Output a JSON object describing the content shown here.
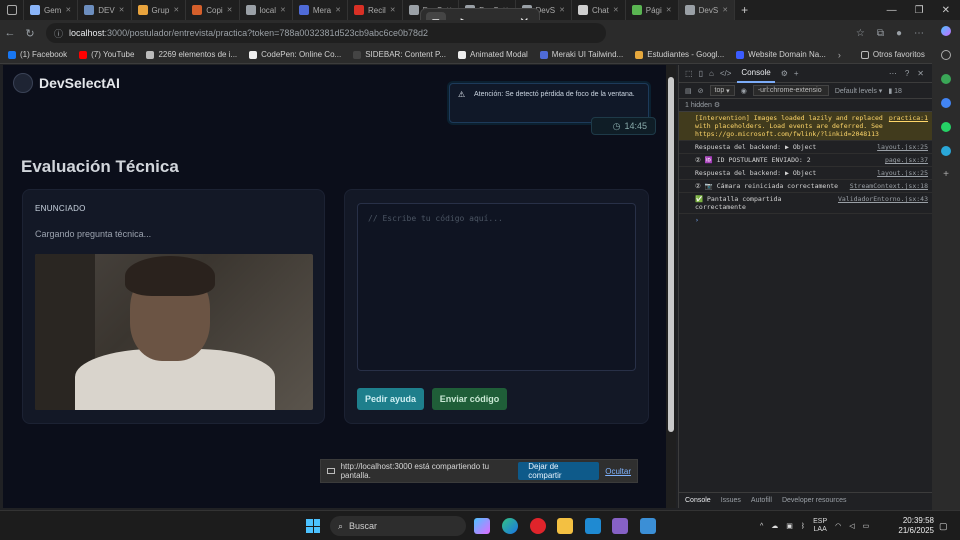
{
  "browser": {
    "tabs": [
      {
        "label": "Gem",
        "color": "#8ab4f8"
      },
      {
        "label": "DEV",
        "color": "#6c8ebf"
      },
      {
        "label": "Grup",
        "color": "#e8a33d"
      },
      {
        "label": "Copi",
        "color": "#d55f2b"
      },
      {
        "label": "local",
        "color": "#9aa0a6"
      },
      {
        "label": "Mera",
        "color": "#4f6bd8"
      },
      {
        "label": "Recil",
        "color": "#d93025"
      },
      {
        "label": "DevS",
        "color": "#9aa0a6"
      },
      {
        "label": "DevS",
        "color": "#9aa0a6"
      },
      {
        "label": "DevS",
        "color": "#9aa0a6"
      },
      {
        "label": "Chat",
        "color": "#cfcfcf"
      },
      {
        "label": "Pági",
        "color": "#5ab552"
      },
      {
        "label": "DevS",
        "color": "#9aa0a6"
      }
    ],
    "url_host": "localhost",
    "url_rest": ":3000/postulador/entrevista/practica?token=788a0032381d523cb9abc6ce0b78d2",
    "bookmarks": [
      {
        "label": "(1) Facebook",
        "color": "#1877f2"
      },
      {
        "label": "(7) YouTube",
        "color": "#ff0000"
      },
      {
        "label": "2269 elementos de i...",
        "color": "#bbbbbb"
      },
      {
        "label": "CodePen: Online Co...",
        "color": "#eeeeee"
      },
      {
        "label": "SIDEBAR: Content P...",
        "color": "#444444"
      },
      {
        "label": "Animated Modal",
        "color": "#eeeeee"
      },
      {
        "label": "Meraki UI Tailwind...",
        "color": "#4f6bd8"
      },
      {
        "label": "Estudiantes - Googl...",
        "color": "#e6a83d"
      },
      {
        "label": "Website Domain Na...",
        "color": "#3b5cff"
      }
    ],
    "other_bookmarks": "Otros favoritos"
  },
  "page": {
    "brand": "DevSelectAI",
    "title": "Evaluación Técnica",
    "question_label": "ENUNCIADO",
    "loading_text": "Cargando pregunta técnica...",
    "editor_placeholder": "// Escribe tu código aquí...",
    "help_button": "Pedir ayuda",
    "send_button": "Enviar código",
    "alert_text": "Atención: Se detectó pérdida de foco de la ventana.",
    "timer": "14:45"
  },
  "share_bar": {
    "message": "http://localhost:3000 está compartiendo tu pantalla.",
    "stop": "Dejar de compartir",
    "hide": "Ocultar"
  },
  "devtools": {
    "tabs": [
      "Console"
    ],
    "context": "top",
    "filter": "-url:chrome-extensio",
    "levels": "Default levels",
    "issues": "18",
    "hidden": "1 hidden",
    "logs": [
      {
        "msg": "[Intervention] Images loaded lazily and replaced with placeholders. Load events are deferred. See https://go.microsoft.com/fwlink/?linkid=2048113",
        "src": "practica:1",
        "kind": "warn"
      },
      {
        "msg": "Respuesta del backend: ▶ Object",
        "src": "layout.jsx:25",
        "kind": "info"
      },
      {
        "msg": "② 🆔 ID POSTULANTE ENVIADO: 2",
        "src": "page.jsx:37",
        "kind": "info"
      },
      {
        "msg": "Respuesta del backend: ▶ Object",
        "src": "layout.jsx:25",
        "kind": "info"
      },
      {
        "msg": "② 📷 Cámara reiniciada correctamente",
        "src": "StreamContext.jsx:18",
        "kind": "info"
      },
      {
        "msg": "✅ Pantalla compartida correctamente",
        "src": "ValidadorEntorno.jsx:43",
        "kind": "info"
      }
    ],
    "bottom_tabs": [
      "Console",
      "Issues",
      "Autofill",
      "Developer resources"
    ]
  },
  "taskbar": {
    "search": "Buscar",
    "lang_line1": "ESP",
    "lang_line2": "LAA",
    "time": "20:39:58",
    "date": "21/6/2025"
  }
}
